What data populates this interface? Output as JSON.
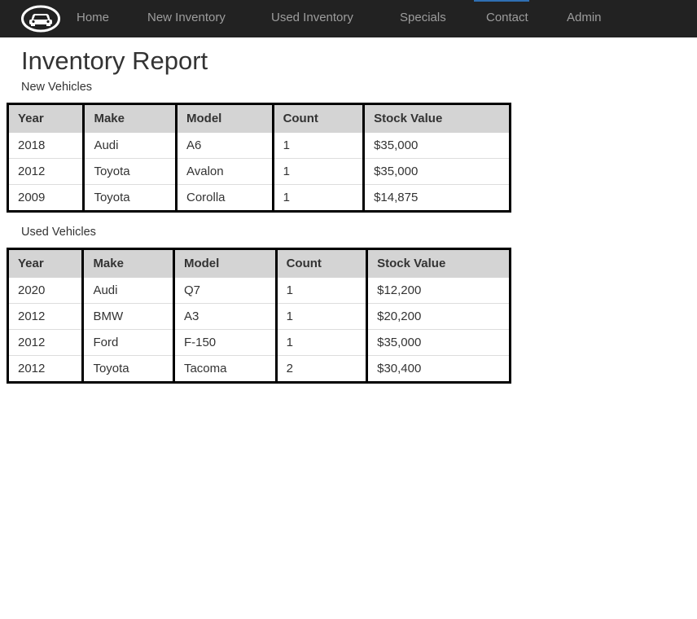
{
  "nav": {
    "brand_icon": "car-icon",
    "links": [
      "Home",
      "New Inventory",
      "Used Inventory",
      "Specials",
      "Contact",
      "Admin"
    ]
  },
  "page": {
    "title": "Inventory Report"
  },
  "new_vehicles": {
    "caption": "New Vehicles",
    "headers": [
      "Year",
      "Make",
      "Model",
      "Count",
      "Stock Value"
    ],
    "rows": [
      [
        "2018",
        "Audi",
        "A6",
        "1",
        "$35,000"
      ],
      [
        "2012",
        "Toyota",
        "Avalon",
        "1",
        "$35,000"
      ],
      [
        "2009",
        "Toyota",
        "Corolla",
        "1",
        "$14,875"
      ]
    ]
  },
  "used_vehicles": {
    "caption": "Used Vehicles",
    "headers": [
      "Year",
      "Make",
      "Model",
      "Count",
      "Stock Value"
    ],
    "rows": [
      [
        "2020",
        "Audi",
        "Q7",
        "1",
        "$12,200"
      ],
      [
        "2012",
        "BMW",
        "A3",
        "1",
        "$20,200"
      ],
      [
        "2012",
        "Ford",
        "F-150",
        "1",
        "$35,000"
      ],
      [
        "2012",
        "Toyota",
        "Tacoma",
        "2",
        "$30,400"
      ]
    ]
  },
  "colors": {
    "navbar_bg": "#222222",
    "nav_link": "#9d9d9d",
    "header_bg": "#d4d4d4",
    "table_border": "#000000"
  }
}
